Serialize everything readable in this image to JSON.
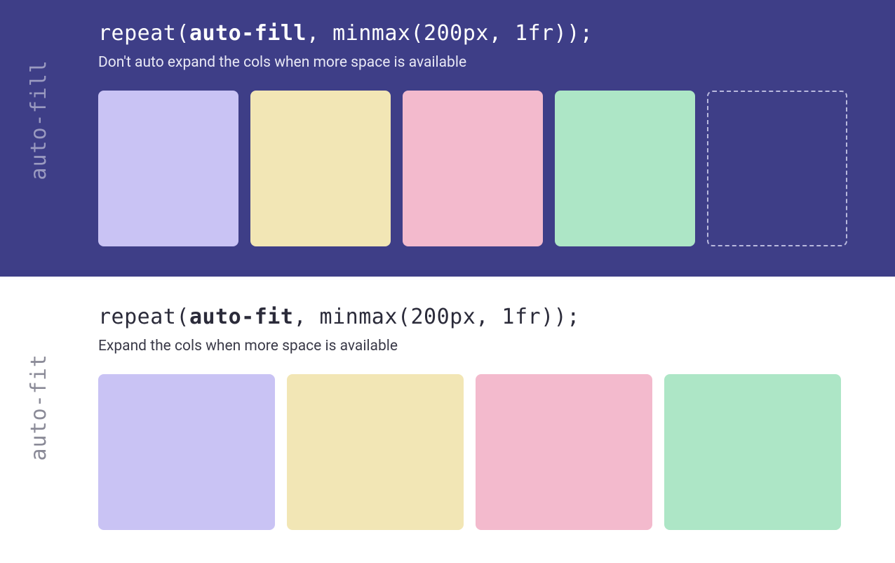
{
  "sections": {
    "fill": {
      "label": "auto-fill",
      "code_pre": "repeat(",
      "code_bold": "auto-fill",
      "code_post": ", minmax(200px, 1fr));",
      "description": "Don't auto expand the cols when more space is available",
      "boxes": [
        "lavender",
        "yellow",
        "pink",
        "green",
        "ghost"
      ]
    },
    "fit": {
      "label": "auto-fit",
      "code_pre": "repeat(",
      "code_bold": "auto-fit",
      "code_post": ", minmax(200px, 1fr));",
      "description": "Expand the cols when more space is available",
      "boxes": [
        "lavender",
        "yellow",
        "pink",
        "green"
      ]
    }
  },
  "colors": {
    "panel_top_bg": "#3e3e87",
    "panel_bottom_bg": "#ffffff",
    "lavender": "#c9c3f4",
    "yellow": "#f2e6b5",
    "pink": "#f3bacd",
    "green": "#ade6c6",
    "ghost_border": "#b9b9dd"
  }
}
